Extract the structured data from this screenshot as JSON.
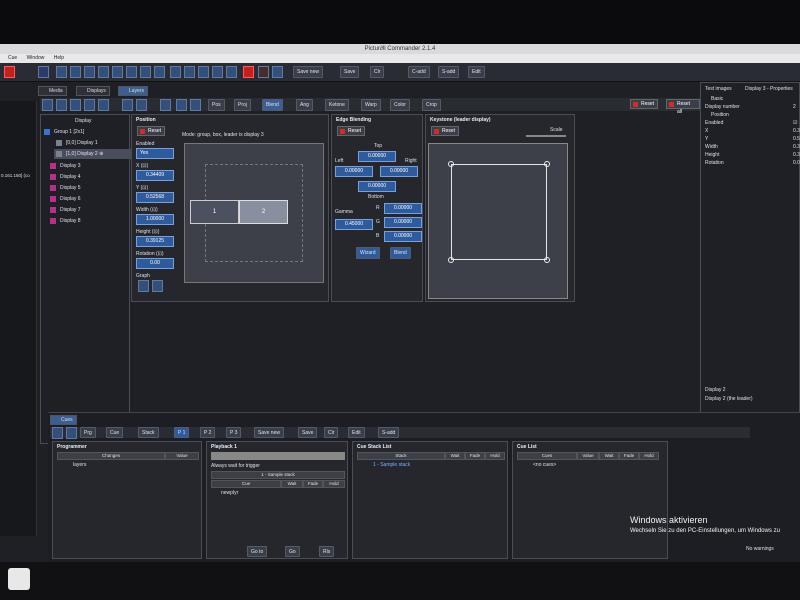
{
  "app": {
    "title": "Pictur∂ll Commander 2.1.4"
  },
  "menu": [
    "Cue",
    "Window",
    "Help"
  ],
  "toolbar": {
    "buttons": [
      "Save new",
      "Save",
      "Clr",
      "C-add",
      "S-add",
      "Edit"
    ]
  },
  "tabs": [
    "Media",
    "Displays",
    "Layers"
  ],
  "subtoolbar": {
    "buttons": [
      "Pos",
      "Proj",
      "Blend",
      "Ang",
      "Ketone",
      "Warp",
      "Color",
      "Crop"
    ],
    "reset": "Reset",
    "reset_all": "Reset all"
  },
  "left_ip": "0.161.150] (co",
  "display_list": {
    "header": "Display",
    "group": "Group 1 [2x1]",
    "children": [
      "[0,0] Display 1",
      "[1,0] Display 2 ⊕"
    ],
    "displays": [
      "Display 3",
      "Display 4",
      "Display 5",
      "Display 6",
      "Display 7",
      "Display 8"
    ]
  },
  "position": {
    "title": "Position",
    "reset": "Reset",
    "mode": "Mode: group, box, leader is display 3",
    "enabled_label": "Enabled",
    "enabled_value": "Yes",
    "x_label": "X (⊡)",
    "x_value": "0.34409",
    "y_label": "Y (⊡)",
    "y_value": "0.52568",
    "w_label": "Width (⊡)",
    "w_value": "1.00000",
    "h_label": "Height (⊡)",
    "h_value": "0.39125",
    "r_label": "Rotation (⊡)",
    "r_value": "0.00",
    "snap_label": "Graph",
    "box1": "1",
    "box2": "2"
  },
  "edge": {
    "title": "Edge Blending",
    "reset": "Reset",
    "top_label": "Top",
    "top_value": "0.00000",
    "left_label": "Left",
    "left_value": "0.00000",
    "right_label": "Right",
    "right_value": "0.00000",
    "bottom_value": "0.00000",
    "bottom_label": "Bottom",
    "gamma_label": "Gamma",
    "gamma_value": "0.45000",
    "r_label": "R",
    "r_value": "0.00000",
    "g_label": "G",
    "g_value": "0.00000",
    "b_label": "B",
    "b_value": "0.00000",
    "btn1": "Wizard",
    "btn2": "Blend"
  },
  "keystone": {
    "title": "Keystone (leader display)",
    "reset": "Reset",
    "scale": "Scale"
  },
  "props": {
    "tab1": "Test images",
    "tab2": "Display 3 - Properties",
    "basic": "Basic",
    "rows": [
      {
        "k": "Display number",
        "v": "2"
      },
      {
        "k": "Position",
        "v": ""
      },
      {
        "k": "Enabled",
        "v": "☑"
      },
      {
        "k": "X",
        "v": "0.3"
      },
      {
        "k": "Y",
        "v": "0.5"
      },
      {
        "k": "Width",
        "v": "0.3"
      },
      {
        "k": "Height",
        "v": "0.3"
      },
      {
        "k": "Rotation",
        "v": "0.0"
      }
    ],
    "footer1": "Display 2",
    "footer2": "Display 2 (the leader)"
  },
  "cues": {
    "tab": "Cues",
    "buttons": [
      "Prg",
      "Cue",
      "Stack",
      "P 1",
      "P 2",
      "P 3",
      "Save new",
      "Save",
      "Clr",
      "Edit",
      "S-add"
    ],
    "programmer": {
      "title": "Programmer",
      "cols": [
        "Changes",
        "Value"
      ],
      "row": "layers"
    },
    "playback": {
      "title": "Playback 1",
      "always": "Always wait for trigger",
      "stack": "1 - Sample stack",
      "cols": [
        "Cue",
        "Wait",
        "Fade",
        "Hold"
      ],
      "row": "newplyr",
      "goto": "Go to",
      "go": "Go",
      "rls": "Rls"
    },
    "stacklist": {
      "title": "Cue Stack List",
      "cols": [
        "Stack",
        "Wait",
        "Fade",
        "Hold"
      ],
      "row": "1 - Sample stack"
    },
    "cuelist": {
      "title": "Cue List",
      "cols": [
        "Cues",
        "Value",
        "Wait",
        "Fade",
        "Hold"
      ],
      "row": "<no cues>"
    }
  },
  "status": {
    "warnings": "No warnings"
  },
  "watermark": {
    "line1": "Windows aktivieren",
    "line2": "Wechseln Sie zu den PC-Einstellungen, um Windows zu"
  }
}
